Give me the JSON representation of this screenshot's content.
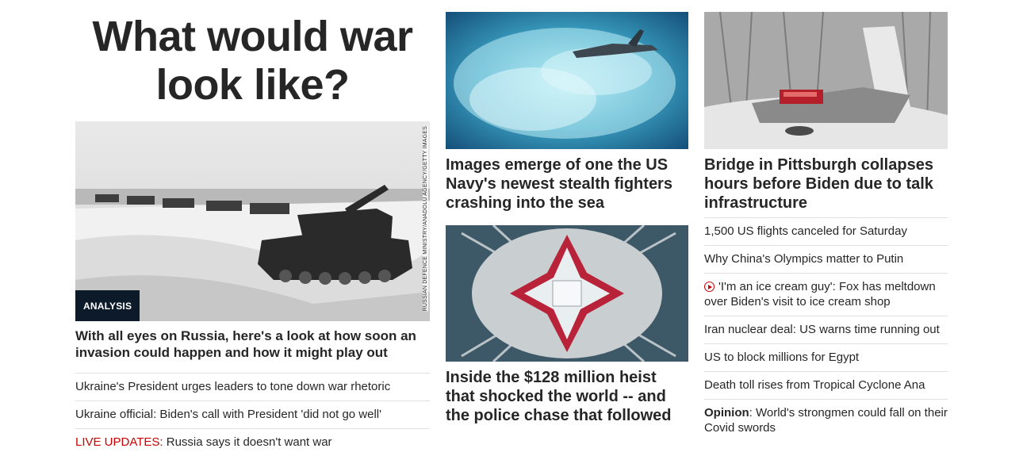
{
  "col1": {
    "headline": "What would war look like?",
    "badge": "ANALYSIS",
    "photo_credit": "RUSSIAN DEFENCE MINISTRY/ANADOLU AGENCY/GETTY IMAGES",
    "story_title": "With all eyes on Russia, here's a look at how soon an invasion could happen and how it might play out",
    "list": [
      {
        "text": "Ukraine's President urges leaders to tone down war rhetoric"
      },
      {
        "text": "Ukraine official: Biden's call with President 'did not go well'"
      },
      {
        "prefix": "LIVE UPDATES:",
        "text": " Russia says it doesn't want war"
      }
    ]
  },
  "col2": {
    "story1_title": "Images emerge of one the US Navy's newest stealth fighters crashing into the sea",
    "story2_title": "Inside the $128 million heist that shocked the world -- and the police chase that followed"
  },
  "col3": {
    "story_title": "Bridge in Pittsburgh collapses hours before Biden due to talk infrastructure",
    "list": [
      {
        "text": "1,500 US flights canceled for Saturday"
      },
      {
        "text": "Why China's Olympics matter to Putin"
      },
      {
        "icon": "play-icon",
        "text": "'I'm an ice cream guy': Fox has meltdown over Biden's visit to ice cream shop"
      },
      {
        "text": "Iran nuclear deal: US warns time running out"
      },
      {
        "text": "US to block millions for Egypt"
      },
      {
        "text": "Death toll rises from Tropical Cyclone Ana"
      },
      {
        "prefix": "Opinion",
        "text": ": World's strongmen could fall on their Covid swords"
      }
    ]
  },
  "colors": {
    "live_red": "#cc0000",
    "badge_bg": "#0c1a2a",
    "text": "#262626",
    "divider": "#e0e0e0"
  }
}
